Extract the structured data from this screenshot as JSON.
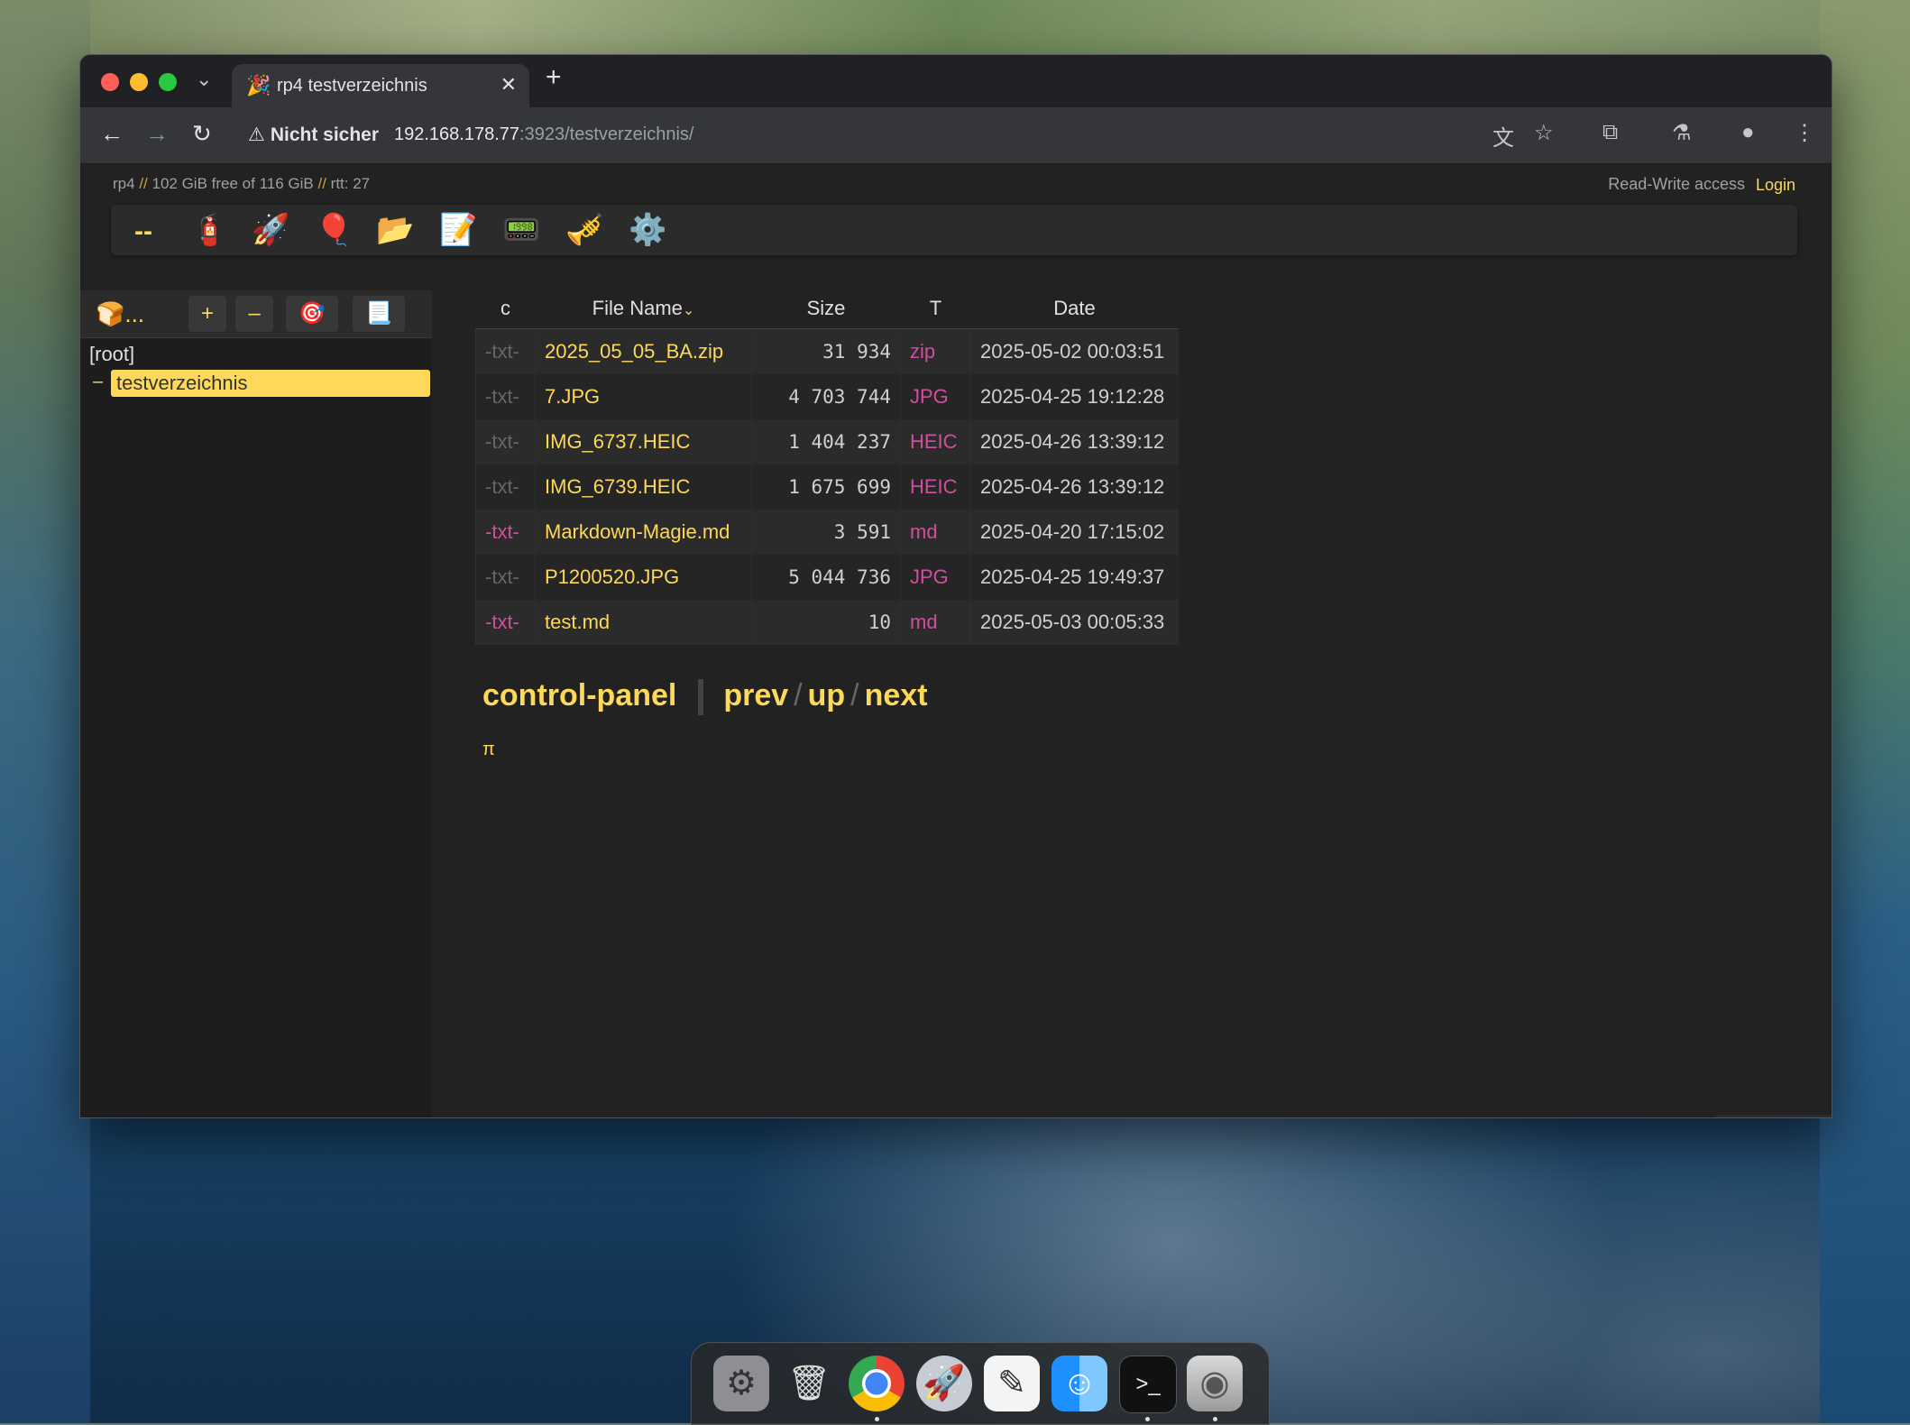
{
  "browser": {
    "tab_title": "rp4 testverzeichnis",
    "tab_favicon": "🎉",
    "security_label": "Nicht sicher",
    "url_host": "192.168.178.77",
    "url_path": ":3923/testverzeichnis/"
  },
  "info": {
    "host": "rp4",
    "sep": "//",
    "disk": "102 GiB free of 116 GiB",
    "rtt": "rtt: 27",
    "access": "Read-Write access",
    "login": "Login"
  },
  "ops": [
    "--",
    "🧯",
    "🚀",
    "🎈",
    "📂",
    "📝",
    "📟",
    "🎺",
    "⚙️"
  ],
  "tree": {
    "buttons": [
      "🍞...",
      "+",
      "–",
      "🎯",
      "📃"
    ],
    "root": "[root]",
    "selected_dash": "–",
    "selected": "testverzeichnis"
  },
  "table": {
    "headers": [
      "c",
      "File Name",
      "Size",
      "T",
      "Date"
    ],
    "sort_indicator": "⌄",
    "rows": [
      {
        "c": "-txt-",
        "name": "2025_05_05_BA.zip",
        "size": "31 934",
        "type": "zip",
        "date": "2025-05-02 00:03:51"
      },
      {
        "c": "-txt-",
        "name": "7.JPG",
        "size": "4 703 744",
        "type": "JPG",
        "date": "2025-04-25 19:12:28"
      },
      {
        "c": "-txt-",
        "name": "IMG_6737.HEIC",
        "size": "1 404 237",
        "type": "HEIC",
        "date": "2025-04-26 13:39:12"
      },
      {
        "c": "-txt-",
        "name": "IMG_6739.HEIC",
        "size": "1 675 699",
        "type": "HEIC",
        "date": "2025-04-26 13:39:12"
      },
      {
        "c": "-txt-",
        "name": "Markdown-Magie.md",
        "size": "3 591",
        "type": "md",
        "date": "2025-04-20 17:15:02"
      },
      {
        "c": "-txt-",
        "name": "P1200520.JPG",
        "size": "5 044 736",
        "type": "JPG",
        "date": "2025-04-25 19:49:37"
      },
      {
        "c": "-txt-",
        "name": "test.md",
        "size": "10",
        "type": "md",
        "date": "2025-05-03 00:05:33"
      }
    ]
  },
  "nav": {
    "control_panel": "control-panel",
    "prev": "prev",
    "up": "up",
    "next": "next",
    "slash": "/",
    "pi": "π"
  },
  "widget": {
    "grid": "⊞",
    "music": "♫"
  },
  "colors": {
    "accent": "#fdd859",
    "type_pink": "#d04e9f",
    "bg": "#222222"
  }
}
